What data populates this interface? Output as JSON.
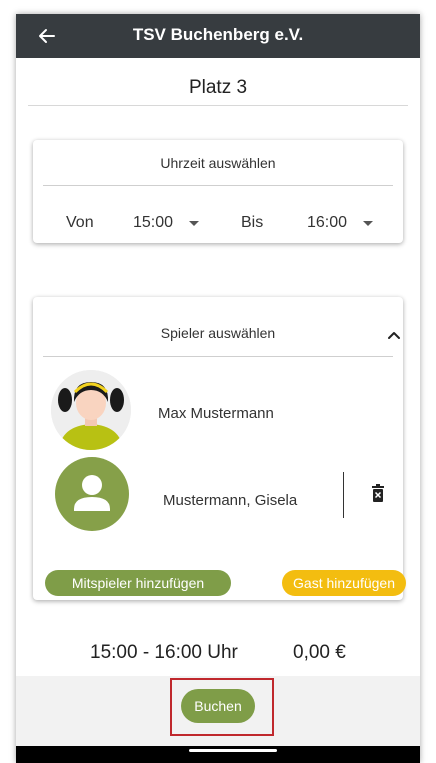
{
  "appbar": {
    "title": "TSV Buchenberg e.V."
  },
  "place": {
    "title": "Platz 3"
  },
  "time_card": {
    "title": "Uhrzeit auswählen",
    "from_label": "Von",
    "from_value": "15:00",
    "to_label": "Bis",
    "to_value": "16:00"
  },
  "players_card": {
    "title": "Spieler auswählen",
    "players": [
      {
        "name": "Max Mustermann"
      },
      {
        "name": "Mustermann, Gisela"
      }
    ],
    "add_player_label": "Mitspieler hinzufügen",
    "add_guest_label": "Gast hinzufügen"
  },
  "summary": {
    "time_range": "15:00 - 16:00 Uhr",
    "price": "0,00 €"
  },
  "actions": {
    "book_label": "Buchen"
  },
  "colors": {
    "appbar": "#373c40",
    "primary_green": "#7f9d48",
    "guest_yellow": "#f3bd10",
    "highlight_red": "#c0282d"
  }
}
